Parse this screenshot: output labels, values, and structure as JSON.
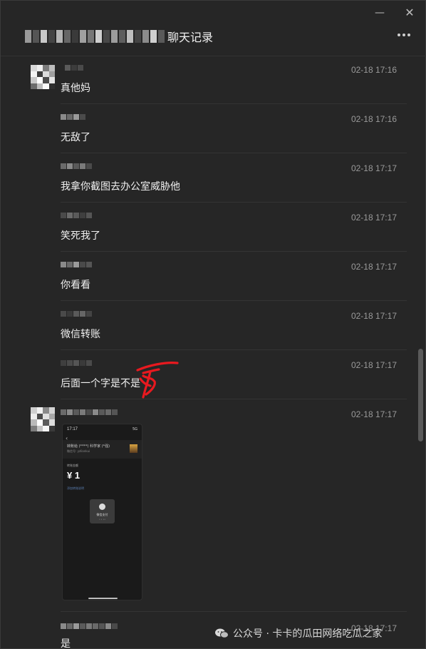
{
  "window": {
    "title": "聊天记录",
    "minimize_glyph": "—",
    "close_glyph": "✕"
  },
  "messages": [
    {
      "time": "02-18 17:16",
      "text": "真他妈"
    },
    {
      "time": "02-18 17:16",
      "text": "无敌了"
    },
    {
      "time": "02-18 17:17",
      "text": "我拿你截图去办公室威胁他"
    },
    {
      "time": "02-18 17:17",
      "text": "笑死我了"
    },
    {
      "time": "02-18 17:17",
      "text": "你看看"
    },
    {
      "time": "02-18 17:17",
      "text": "微信转账"
    },
    {
      "time": "02-18 17:17",
      "text": "后面一个字是不是"
    },
    {
      "time": "02-18 17:17",
      "text": ""
    },
    {
      "time": "02-18 17:17",
      "text": "是"
    }
  ],
  "screenshot": {
    "status_time": "17:17",
    "status_right": "5G",
    "card_title": "转账给 (****) 科学家 (*强)",
    "card_sub": "微信号: yzliankui",
    "amount_label": "转账金额",
    "amount": "¥ 1",
    "link": "添加转账说明",
    "pay_button": "微信支付",
    "pay_sub": "• • ••"
  },
  "watermark": {
    "text": "公众号 · 卡卡的瓜田网络吃瓜之家",
    "icon": "wechat-icon"
  },
  "colors": {
    "background": "#262626",
    "annotation": "#e8191f"
  }
}
